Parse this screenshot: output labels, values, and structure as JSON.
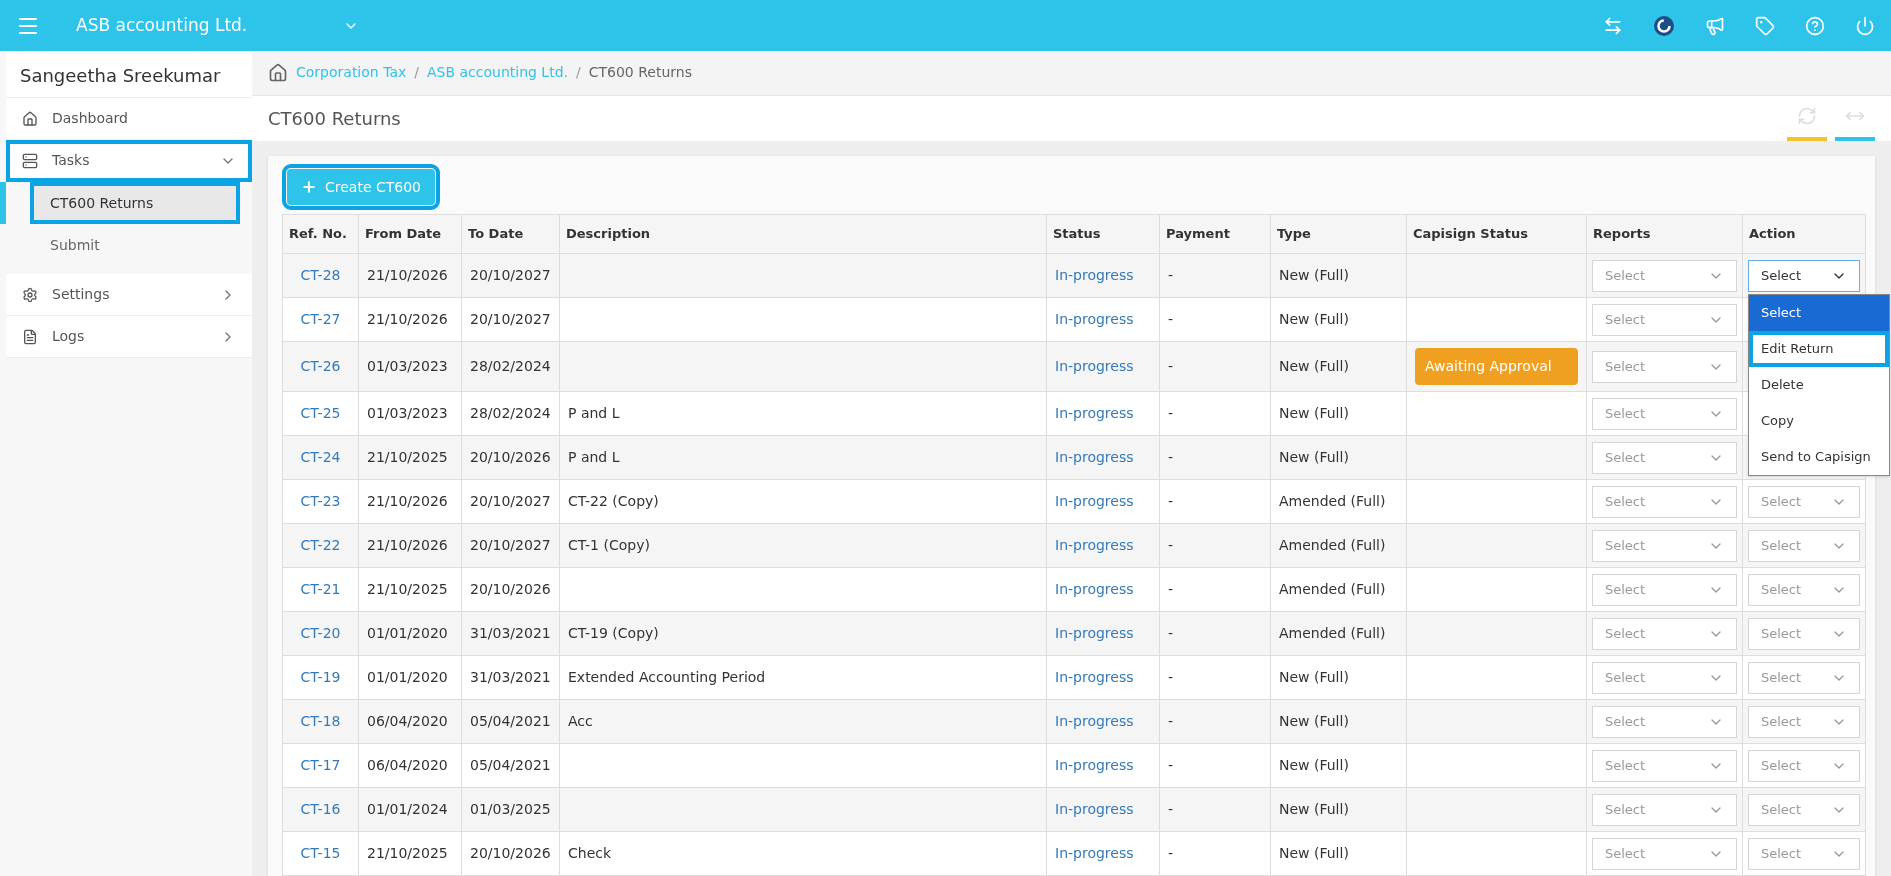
{
  "top_bar": {
    "company": "ASB accounting Ltd."
  },
  "sidebar": {
    "user": "Sangeetha Sreekumar",
    "items": [
      {
        "label": "Dashboard",
        "kind": "link",
        "highlighted": false
      },
      {
        "label": "Tasks",
        "kind": "group",
        "expanded": true,
        "highlighted": true,
        "children": [
          {
            "label": "CT600 Returns",
            "selected": true,
            "highlighted": true
          },
          {
            "label": "Submit",
            "selected": false,
            "highlighted": false
          }
        ]
      },
      {
        "label": "Settings",
        "kind": "group",
        "expanded": false,
        "highlighted": false
      },
      {
        "label": "Logs",
        "kind": "group",
        "expanded": false,
        "highlighted": false
      }
    ]
  },
  "breadcrumb": [
    {
      "label": "Corporation Tax",
      "link": true,
      "separator": "/"
    },
    {
      "label": "ASB accounting Ltd.",
      "link": true,
      "separator": "/"
    },
    {
      "label": "CT600 Returns",
      "link": false
    }
  ],
  "page_title": "CT600 Returns",
  "create_button": {
    "label": "Create CT600",
    "highlighted": true
  },
  "table": {
    "columns": [
      "Ref. No.",
      "From Date",
      "To Date",
      "Description",
      "Status",
      "Payment",
      "Type",
      "Capisign Status",
      "Reports",
      "Action"
    ],
    "rows": [
      {
        "ref": "CT-28",
        "from": "21/10/2026",
        "to": "20/10/2027",
        "status": "In-progress",
        "payment": "-",
        "type": "New (Full)",
        "reports": "Select",
        "action": "Select",
        "action_open": true
      },
      {
        "ref": "CT-27",
        "from": "21/10/2026",
        "to": "20/10/2027",
        "status": "In-progress",
        "payment": "-",
        "type": "New (Full)",
        "reports": "Select"
      },
      {
        "ref": "CT-26",
        "from": "01/03/2023",
        "to": "28/02/2024",
        "status": "In-progress",
        "payment": "-",
        "type": "New (Full)",
        "capisign_status": "Awaiting Approval",
        "reports": "Select"
      },
      {
        "ref": "CT-25",
        "from": "01/03/2023",
        "to": "28/02/2024",
        "description": "P and L",
        "status": "In-progress",
        "payment": "-",
        "type": "New (Full)",
        "reports": "Select"
      },
      {
        "ref": "CT-24",
        "from": "21/10/2025",
        "to": "20/10/2026",
        "description": "P and L",
        "status": "In-progress",
        "payment": "-",
        "type": "New (Full)",
        "reports": "Select"
      },
      {
        "ref": "CT-23",
        "from": "21/10/2026",
        "to": "20/10/2027",
        "description": "CT-22 (Copy)",
        "status": "In-progress",
        "payment": "-",
        "type": "Amended (Full)",
        "reports": "Select",
        "action": "Select",
        "action_open": false
      },
      {
        "ref": "CT-22",
        "from": "21/10/2026",
        "to": "20/10/2027",
        "description": "CT-1 (Copy)",
        "status": "In-progress",
        "payment": "-",
        "type": "Amended (Full)",
        "reports": "Select",
        "action": "Select",
        "action_open": false
      },
      {
        "ref": "CT-21",
        "from": "21/10/2025",
        "to": "20/10/2026",
        "status": "In-progress",
        "payment": "-",
        "type": "Amended (Full)",
        "reports": "Select",
        "action": "Select",
        "action_open": false
      },
      {
        "ref": "CT-20",
        "from": "01/01/2020",
        "to": "31/03/2021",
        "description": "CT-19 (Copy)",
        "status": "In-progress",
        "payment": "-",
        "type": "Amended (Full)",
        "reports": "Select",
        "action": "Select",
        "action_open": false
      },
      {
        "ref": "CT-19",
        "from": "01/01/2020",
        "to": "31/03/2021",
        "description": "Extended Accounting Period",
        "status": "In-progress",
        "payment": "-",
        "type": "New (Full)",
        "reports": "Select",
        "action": "Select",
        "action_open": false
      },
      {
        "ref": "CT-18",
        "from": "06/04/2020",
        "to": "05/04/2021",
        "description": "Acc",
        "status": "In-progress",
        "payment": "-",
        "type": "New (Full)",
        "reports": "Select",
        "action": "Select",
        "action_open": false
      },
      {
        "ref": "CT-17",
        "from": "06/04/2020",
        "to": "05/04/2021",
        "status": "In-progress",
        "payment": "-",
        "type": "New (Full)",
        "reports": "Select",
        "action": "Select",
        "action_open": false
      },
      {
        "ref": "CT-16",
        "from": "01/01/2024",
        "to": "01/03/2025",
        "status": "In-progress",
        "payment": "-",
        "type": "New (Full)",
        "reports": "Select",
        "action": "Select",
        "action_open": false
      },
      {
        "ref": "CT-15",
        "from": "21/10/2025",
        "to": "20/10/2026",
        "description": "Check",
        "status": "In-progress",
        "payment": "-",
        "type": "New (Full)",
        "reports": "Select",
        "action": "Select",
        "action_open": false
      }
    ],
    "action_menu": [
      {
        "label": "Select",
        "selected": true,
        "highlighted": false
      },
      {
        "label": "Edit Return",
        "selected": false,
        "highlighted": true
      },
      {
        "label": "Delete",
        "selected": false,
        "highlighted": false
      },
      {
        "label": "Copy",
        "selected": false,
        "highlighted": false
      },
      {
        "label": "Send to Capisign",
        "selected": false,
        "highlighted": false
      }
    ]
  }
}
